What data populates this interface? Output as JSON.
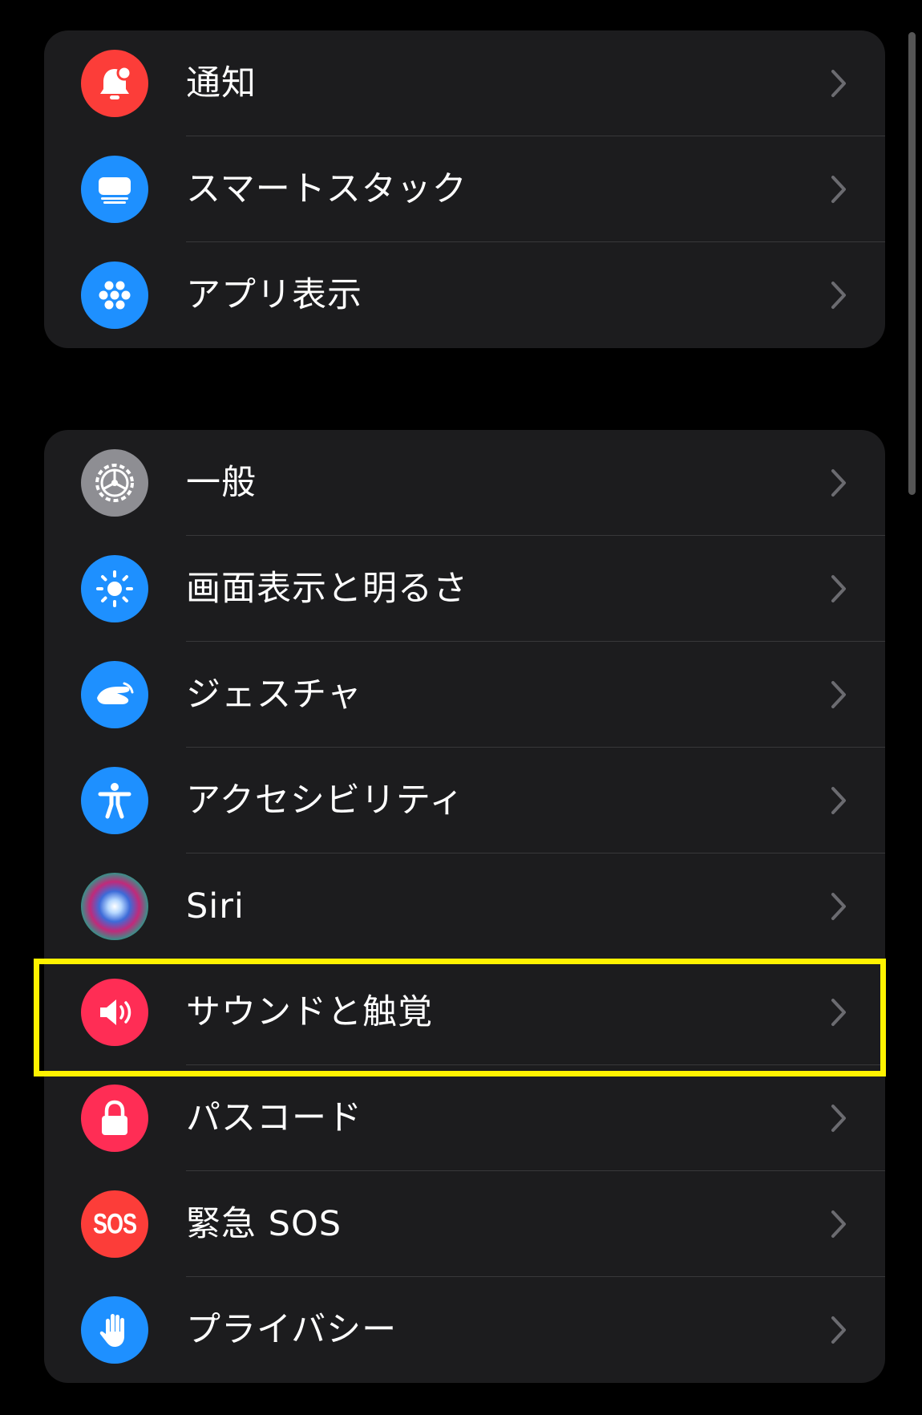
{
  "group1": {
    "items": [
      {
        "label": "通知",
        "icon": "notification-bell-icon",
        "color": "#fc3d39"
      },
      {
        "label": "スマートスタック",
        "icon": "smart-stack-icon",
        "color": "#1e90ff"
      },
      {
        "label": "アプリ表示",
        "icon": "app-grid-icon",
        "color": "#1e90ff"
      }
    ]
  },
  "group2": {
    "items": [
      {
        "label": "一般",
        "icon": "gear-icon",
        "color": "#8e8e93"
      },
      {
        "label": "画面表示と明るさ",
        "icon": "brightness-sun-icon",
        "color": "#1e90ff"
      },
      {
        "label": "ジェスチャ",
        "icon": "gesture-hand-icon",
        "color": "#1e90ff"
      },
      {
        "label": "アクセシビリティ",
        "icon": "accessibility-person-icon",
        "color": "#1e90ff"
      },
      {
        "label": "Siri",
        "icon": "siri-orb-icon",
        "color": "#2b2b6e"
      },
      {
        "label": "サウンドと触覚",
        "icon": "speaker-icon",
        "color": "#ff2d55"
      },
      {
        "label": "パスコード",
        "icon": "lock-icon",
        "color": "#ff2d55"
      },
      {
        "label": "緊急 SOS",
        "icon": "sos-icon",
        "color": "#fc3d39",
        "icon_text": "SOS"
      },
      {
        "label": "プライバシー",
        "icon": "privacy-hand-icon",
        "color": "#1e90ff"
      }
    ]
  },
  "highlight_color": "#fff200"
}
